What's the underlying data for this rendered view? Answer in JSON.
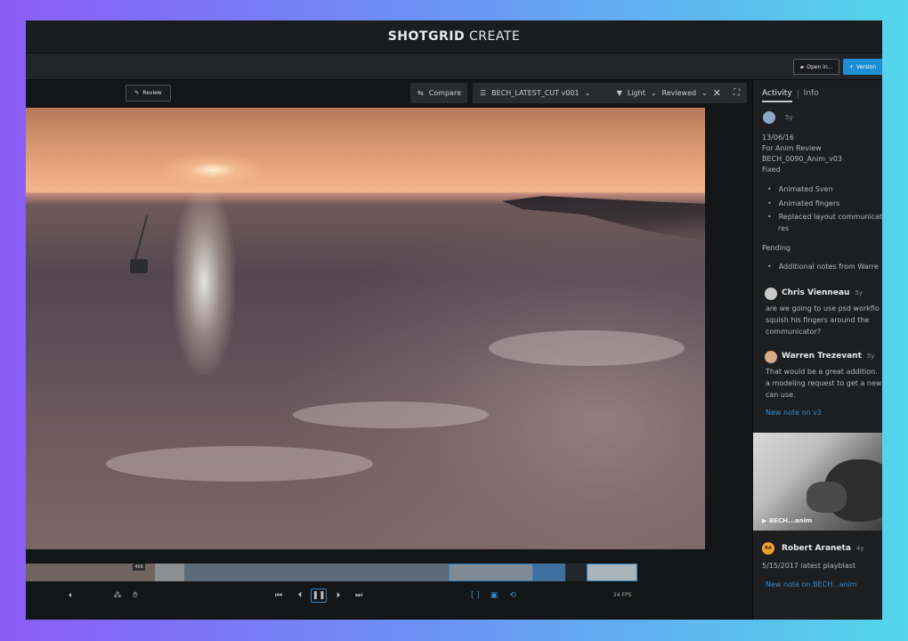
{
  "app": {
    "brand_bold": "SHOTGRID",
    "brand_light": "CREATE"
  },
  "header": {
    "open_in_label": "Open in...",
    "version_label": "Version"
  },
  "toolbar": {
    "review_label": "Review",
    "compare_label": "Compare",
    "cut_label": "BECH_LATEST_CUT v001",
    "filter_light": "Light",
    "filter_reviewed": "Reviewed"
  },
  "timeline": {
    "frame_label": "456",
    "fps_label": "24 FPS"
  },
  "panel": {
    "tabs": [
      {
        "label": "Activity"
      },
      {
        "label": "Info"
      }
    ],
    "note": {
      "age": "5y",
      "date": "13/06/16",
      "for_line": "For Anim Review",
      "version_line": "BECH_0090_Anim_v03",
      "status_line": "Fixed",
      "fixed_items": [
        "Animated Sven",
        "Animated fingers",
        "Replaced layout communicat",
        "res"
      ],
      "pending_label": "Pending",
      "pending_items": [
        "Additional notes from Warre"
      ]
    },
    "replies": [
      {
        "name": "Chris Vienneau",
        "age": "5y",
        "lines": [
          "are we going to use psd workflo",
          "squish his fingers around the",
          "communicator?"
        ]
      },
      {
        "name": "Warren Trezevant",
        "age": "5y",
        "lines": [
          "That would be a great addition.",
          "a modeling request to get a new",
          "can use."
        ]
      }
    ],
    "new_note_link": "New note on v3",
    "thumb_caption": "BECH...anim",
    "second_author": {
      "initials": "RA",
      "name": "Robert Araneta",
      "age": "4y"
    },
    "second_note": "5/15/2017 latest playblast",
    "second_link": "New note on BECH...anim"
  }
}
